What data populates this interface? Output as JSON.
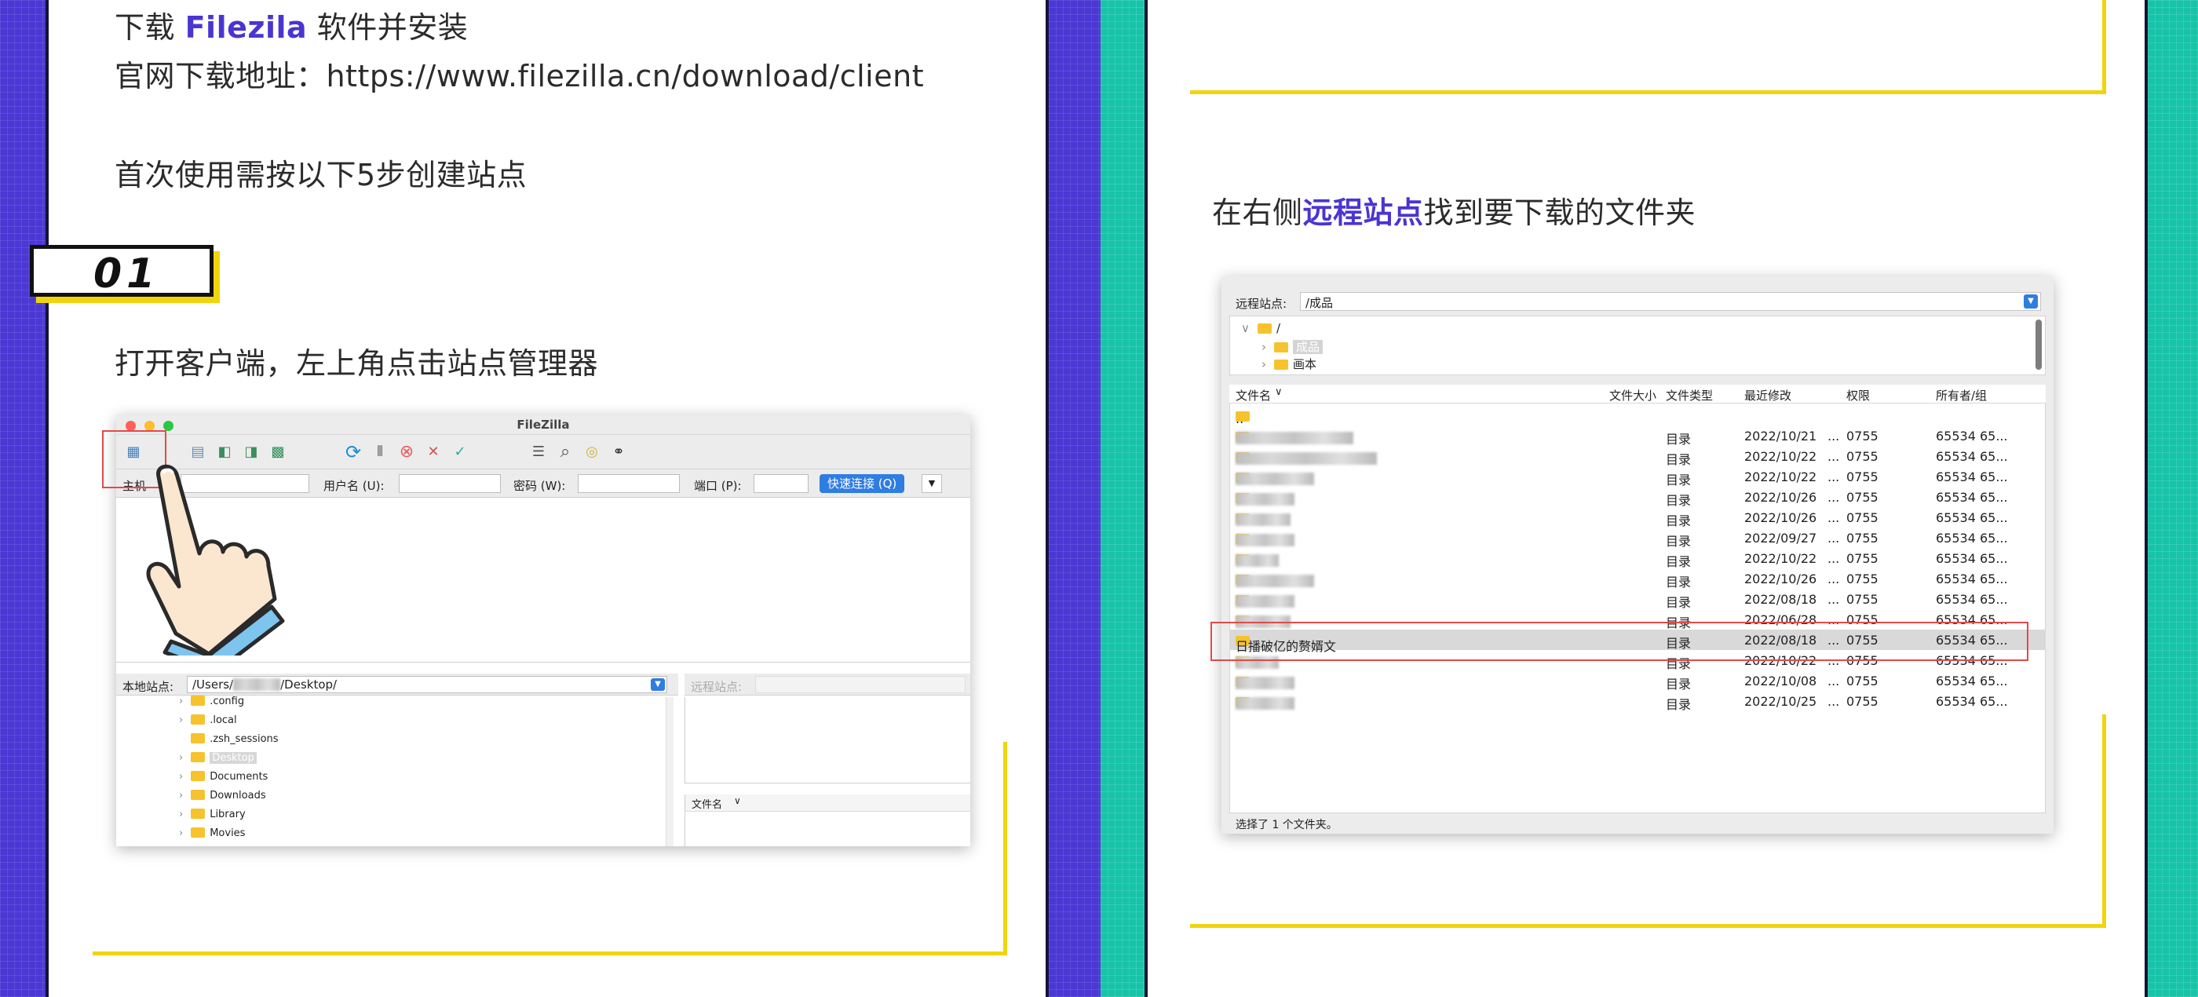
{
  "colors": {
    "accent_blue": "#4a35d1",
    "teal": "#17c4a8",
    "yellow": "#f2d40d",
    "red_frame": "#e24a4a"
  },
  "left": {
    "line1_prefix": "下载 ",
    "line1_highlight": "Filezila",
    "line1_suffix": " 软件并安装",
    "line2": "官网下载地址：https://www.filezilla.cn/download/client",
    "line3": "首次使用需按以下5步创建站点",
    "badge": "01",
    "step1": "打开客户端，左上角点击站点管理器"
  },
  "filezilla": {
    "title": "FileZilla",
    "host_label": "主机",
    "user_label": "用户名 (U):",
    "pass_label": "密码 (W):",
    "port_label": "端口 (P):",
    "quickconnect": "快速连接 (Q)",
    "local_site_label": "本地站点:",
    "local_path_a": "/Users/",
    "local_path_b": "/Desktop/",
    "remote_site_label": "远程站点:",
    "filename_col": "文件名",
    "tree": [
      ".config",
      ".local",
      ".zsh_sessions",
      "Desktop",
      "Documents",
      "Downloads",
      "Library",
      "Movies"
    ]
  },
  "right": {
    "caption_prefix": "在右侧",
    "caption_highlight": "远程站点",
    "caption_suffix": "找到要下载的文件夹",
    "remote_label": "远程站点:",
    "remote_path": "/成品",
    "tree_root": "/",
    "tree_child1": "成品",
    "tree_child2": "画本",
    "headers": {
      "name": "文件名",
      "size": "文件大小",
      "type": "文件类型",
      "modified": "最近修改",
      "perm": "权限",
      "owner": "所有者/组"
    },
    "parent_dir": "..",
    "rows": [
      {
        "name": "",
        "type": "目录",
        "date": "2022/10/21",
        "perm": "0755",
        "owner": "65534 65..."
      },
      {
        "name": "",
        "type": "目录",
        "date": "2022/10/22",
        "perm": "0755",
        "owner": "65534 65..."
      },
      {
        "name": "",
        "type": "目录",
        "date": "2022/10/22",
        "perm": "0755",
        "owner": "65534 65..."
      },
      {
        "name": "",
        "type": "目录",
        "date": "2022/10/26",
        "perm": "0755",
        "owner": "65534 65..."
      },
      {
        "name": "",
        "type": "目录",
        "date": "2022/10/26",
        "perm": "0755",
        "owner": "65534 65..."
      },
      {
        "name": "",
        "type": "目录",
        "date": "2022/09/27",
        "perm": "0755",
        "owner": "65534 65..."
      },
      {
        "name": "",
        "type": "目录",
        "date": "2022/10/22",
        "perm": "0755",
        "owner": "65534 65..."
      },
      {
        "name": "",
        "type": "目录",
        "date": "2022/10/26",
        "perm": "0755",
        "owner": "65534 65..."
      },
      {
        "name": "",
        "type": "目录",
        "date": "2022/08/18",
        "perm": "0755",
        "owner": "65534 65..."
      },
      {
        "name": "",
        "type": "目录",
        "date": "2022/06/28",
        "perm": "0755",
        "owner": "65534 65..."
      },
      {
        "name": "日播破亿的赘婿文",
        "type": "目录",
        "date": "2022/08/18",
        "perm": "0755",
        "owner": "65534 65..."
      },
      {
        "name": "",
        "type": "目录",
        "date": "2022/10/22",
        "perm": "0755",
        "owner": "65534 65..."
      },
      {
        "name": "",
        "type": "目录",
        "date": "2022/10/08",
        "perm": "0755",
        "owner": "65534 65..."
      },
      {
        "name": "",
        "type": "目录",
        "date": "2022/10/25",
        "perm": "0755",
        "owner": "65534 65..."
      }
    ],
    "date_suffix": "...",
    "status": "选择了 1 个文件夹。"
  }
}
